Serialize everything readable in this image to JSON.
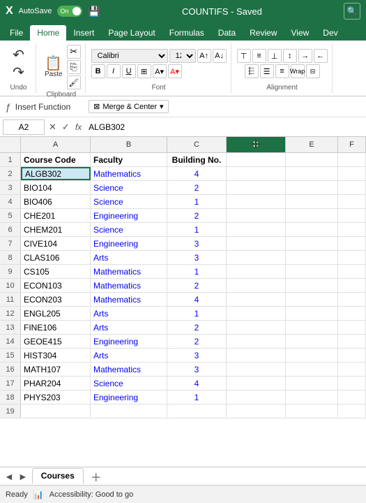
{
  "titleBar": {
    "logo": "X",
    "autosave": "AutoSave",
    "toggleState": "On",
    "title": "COUNTIFS - Saved",
    "searchIcon": "🔍"
  },
  "ribbonTabs": [
    "File",
    "Home",
    "Insert",
    "Page Layout",
    "Formulas",
    "Data",
    "Review",
    "View",
    "Dev"
  ],
  "activeTab": "Home",
  "ribbon": {
    "undoGroup": {
      "label": "Undo",
      "undoIcon": "↶",
      "redoIcon": "↷"
    },
    "clipboardGroup": {
      "label": "Clipboard",
      "pasteLabel": "Paste"
    },
    "fontGroup": {
      "label": "Font",
      "fontName": "Calibri",
      "fontSize": "12"
    },
    "alignmentGroup": {
      "label": "Alignment"
    }
  },
  "insertFuncBar": {
    "label": "Insert Function",
    "mergeBtnLabel": "Merge & Center",
    "mergeDropIcon": "▾"
  },
  "formulaBar": {
    "nameBox": "A2",
    "formulaContent": "ALGB302"
  },
  "columns": [
    "A",
    "B",
    "C",
    "D",
    "E",
    "F"
  ],
  "headers": [
    "Course Code",
    "Faculty",
    "Building No.",
    "",
    "",
    ""
  ],
  "rows": [
    {
      "num": 1,
      "a": "Course Code",
      "b": "Faculty",
      "c": "Building No.",
      "d": "",
      "e": "",
      "f": "",
      "aStyle": "bold",
      "cStyle": "bold"
    },
    {
      "num": 2,
      "a": "ALGB302",
      "b": "Mathematics",
      "c": "4",
      "d": "",
      "e": "",
      "f": "",
      "selected": true,
      "bColor": "blue",
      "cColor": "blue"
    },
    {
      "num": 3,
      "a": "BIO104",
      "b": "Science",
      "c": "2",
      "d": "",
      "e": "",
      "f": "",
      "bColor": "blue",
      "cColor": "blue"
    },
    {
      "num": 4,
      "a": "BIO406",
      "b": "Science",
      "c": "1",
      "d": "",
      "e": "",
      "f": "",
      "bColor": "blue",
      "cColor": "blue"
    },
    {
      "num": 5,
      "a": "CHE201",
      "b": "Engineering",
      "c": "2",
      "d": "",
      "e": "",
      "f": "",
      "bColor": "blue",
      "cColor": "blue"
    },
    {
      "num": 6,
      "a": "CHEM201",
      "b": "Science",
      "c": "1",
      "d": "",
      "e": "",
      "f": "",
      "bColor": "blue",
      "cColor": "blue"
    },
    {
      "num": 7,
      "a": "CIVE104",
      "b": "Engineering",
      "c": "3",
      "d": "",
      "e": "",
      "f": "",
      "bColor": "blue",
      "cColor": "blue"
    },
    {
      "num": 8,
      "a": "CLAS106",
      "b": "Arts",
      "c": "3",
      "d": "",
      "e": "",
      "f": "",
      "bColor": "blue",
      "cColor": "blue"
    },
    {
      "num": 9,
      "a": "CS105",
      "b": "Mathematics",
      "c": "1",
      "d": "",
      "e": "",
      "f": "",
      "bColor": "blue",
      "cColor": "blue"
    },
    {
      "num": 10,
      "a": "ECON103",
      "b": "Mathematics",
      "c": "2",
      "d": "",
      "e": "",
      "f": "",
      "bColor": "blue",
      "cColor": "blue"
    },
    {
      "num": 11,
      "a": "ECON203",
      "b": "Mathematics",
      "c": "4",
      "d": "",
      "e": "",
      "f": "",
      "bColor": "blue",
      "cColor": "blue"
    },
    {
      "num": 12,
      "a": "ENGL205",
      "b": "Arts",
      "c": "1",
      "d": "",
      "e": "",
      "f": "",
      "bColor": "blue",
      "cColor": "blue"
    },
    {
      "num": 13,
      "a": "FINE106",
      "b": "Arts",
      "c": "2",
      "d": "",
      "e": "",
      "f": "",
      "bColor": "blue",
      "cColor": "blue"
    },
    {
      "num": 14,
      "a": "GEOE415",
      "b": "Engineering",
      "c": "2",
      "d": "",
      "e": "",
      "f": "",
      "bColor": "blue",
      "cColor": "blue"
    },
    {
      "num": 15,
      "a": "HIST304",
      "b": "Arts",
      "c": "3",
      "d": "",
      "e": "",
      "f": "",
      "bColor": "blue",
      "cColor": "blue"
    },
    {
      "num": 16,
      "a": "MATH107",
      "b": "Mathematics",
      "c": "3",
      "d": "",
      "e": "",
      "f": "",
      "bColor": "blue",
      "cColor": "blue"
    },
    {
      "num": 17,
      "a": "PHAR204",
      "b": "Science",
      "c": "4",
      "d": "",
      "e": "",
      "f": "",
      "bColor": "blue",
      "cColor": "blue"
    },
    {
      "num": 18,
      "a": "PHYS203",
      "b": "Engineering",
      "c": "1",
      "d": "",
      "e": "",
      "f": "",
      "bColor": "blue",
      "cColor": "blue"
    },
    {
      "num": 19,
      "a": "",
      "b": "",
      "c": "",
      "d": "",
      "e": "",
      "f": ""
    }
  ],
  "sheetTabs": {
    "active": "Courses",
    "sheets": [
      "Courses"
    ]
  },
  "statusBar": {
    "status": "Ready",
    "accessibility": "Accessibility: Good to go"
  }
}
